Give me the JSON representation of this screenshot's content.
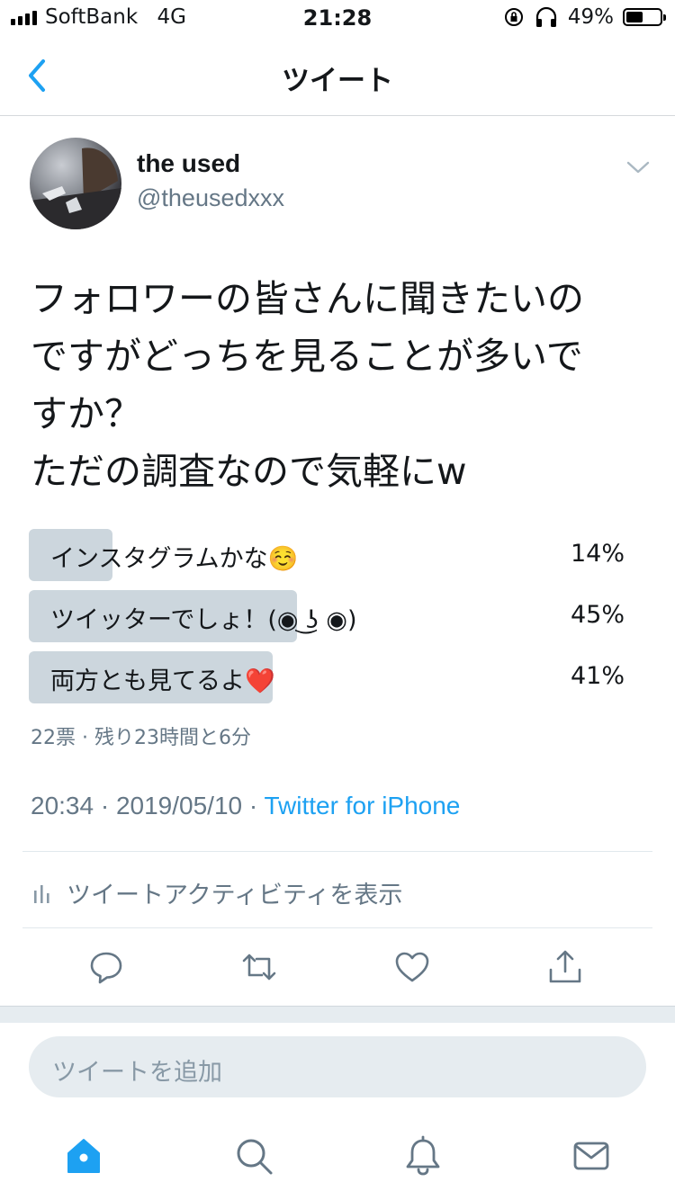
{
  "status_bar": {
    "carrier": "SoftBank",
    "network": "4G",
    "time": "21:28",
    "battery": "49%",
    "battery_level": 0.49
  },
  "nav": {
    "title": "ツイート",
    "back_icon": "chevron-left-icon"
  },
  "tweet": {
    "author_name": "the used",
    "author_handle": "@theusedxxx",
    "text": "フォロワーの皆さんに聞きたいの\nですがどっちを見ることが多いで\nすか？\nただの調査なので気軽にw",
    "poll": {
      "options": [
        {
          "label": "インスタグラムかな☺️",
          "percent": "14%",
          "fraction": 0.14
        },
        {
          "label": "ツイッターでしょ！(◉ ͜ʖ ◉)",
          "percent": "45%",
          "fraction": 0.45
        },
        {
          "label": "両方とも見てるよ❤️",
          "percent": "41%",
          "fraction": 0.41
        }
      ],
      "meta": "22票 · 残り23時間と6分"
    },
    "time": "20:34",
    "date": "2019/05/10",
    "source": "Twitter for iPhone",
    "activity_label": "ツイートアクティビティを表示"
  },
  "compose": {
    "placeholder": "ツイートを追加"
  },
  "colors": {
    "accent": "#1da1f2",
    "muted": "#657786",
    "poll_bar": "#ccd6dd"
  }
}
